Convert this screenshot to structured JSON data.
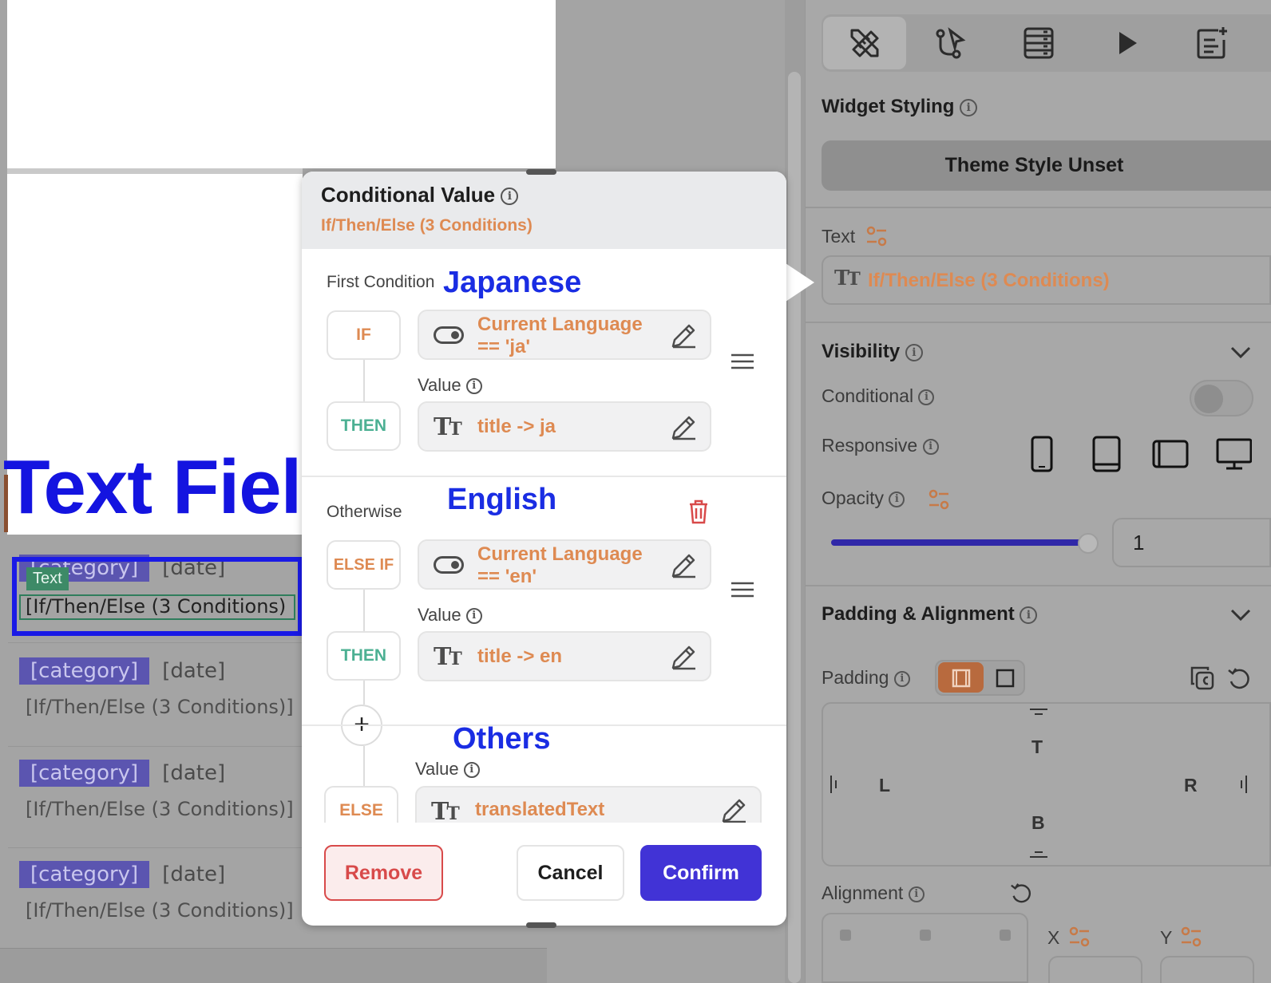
{
  "canvas": {
    "selected_tag": "Text",
    "list_items": [
      {
        "category": "[category]",
        "date": "[date]",
        "text": "[If/Then/Else (3 Conditions)"
      },
      {
        "category": "[category]",
        "date": "[date]",
        "text": "[If/Then/Else (3 Conditions)]"
      },
      {
        "category": "[category]",
        "date": "[date]",
        "text": "[If/Then/Else (3 Conditions)]"
      },
      {
        "category": "[category]",
        "date": "[date]",
        "text": "[If/Then/Else (3 Conditions)]"
      }
    ]
  },
  "annotations": {
    "text_field": "Text Field",
    "japanese": "Japanese",
    "english": "English",
    "others": "Others"
  },
  "modal": {
    "title": "Conditional Value",
    "subtitle": "If/Then/Else (3 Conditions)",
    "first_condition_label": "First Condition",
    "otherwise_label": "Otherwise",
    "value_label": "Value",
    "if_label": "IF",
    "then_label": "THEN",
    "else_if_label": "ELSE IF",
    "else_label": "ELSE",
    "cond1_line1": "Current Language",
    "cond1_line2": "== 'ja'",
    "then1_value": "title -> ja",
    "cond2_line1": "Current Language",
    "cond2_line2": "== 'en'",
    "then2_value": "title -> en",
    "else_value": "translatedText",
    "add_symbol": "+",
    "remove_label": "Remove",
    "cancel_label": "Cancel",
    "confirm_label": "Confirm",
    "icon_info": "i"
  },
  "panel": {
    "widget_styling": "Widget Styling",
    "theme_button": "Theme Style Unset",
    "text_label": "Text",
    "text_value": "If/Then/Else (3 Conditions)",
    "visibility": "Visibility",
    "conditional": "Conditional",
    "responsive": "Responsive",
    "opacity": "Opacity",
    "opacity_value": "1",
    "opacity_level": 0.95,
    "padding_alignment": "Padding & Alignment",
    "padding": "Padding",
    "pad_top": "T",
    "pad_left": "L",
    "pad_right": "R",
    "pad_bottom": "B",
    "alignment": "Alignment",
    "x_label": "X",
    "y_label": "Y"
  },
  "colors": {
    "accent_orange": "#de8a52",
    "then_green": "#4cb093",
    "confirm_blue": "#4133d6",
    "annotation_blue": "#1a2de3",
    "remove_red": "#d84a4a"
  }
}
